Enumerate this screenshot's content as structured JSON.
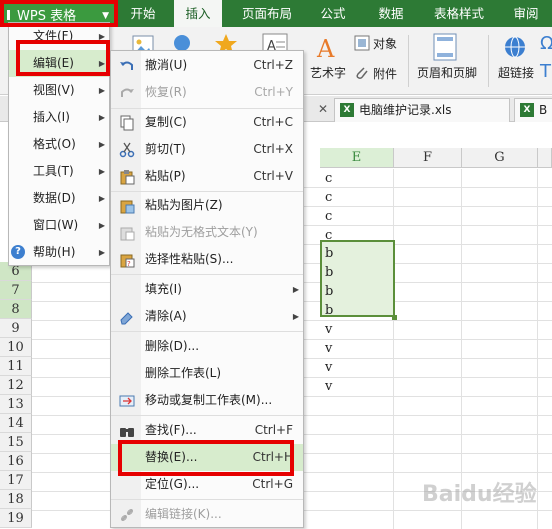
{
  "app": {
    "title": "WPS 表格"
  },
  "menubar": {
    "tabs": [
      "开始",
      "插入",
      "页面布局",
      "公式",
      "数据",
      "表格样式",
      "审阅"
    ]
  },
  "ribbon": {
    "art_text": "艺术字",
    "object": "对象",
    "attachment": "附件",
    "header_footer": "页眉和页脚",
    "hyperlink": "超链接"
  },
  "filetabs": {
    "tab1": "电脑维护记录.xls",
    "tab2": "B"
  },
  "grid": {
    "columns": [
      "E",
      "F",
      "G"
    ],
    "rows": [
      "6",
      "7",
      "8",
      "9",
      "10",
      "11",
      "12",
      "13",
      "14",
      "15",
      "16",
      "17",
      "18",
      "19"
    ],
    "e_values": [
      "c",
      "c",
      "c",
      "c",
      "b",
      "b",
      "b",
      "b",
      "v",
      "v",
      "v",
      "v"
    ]
  },
  "main_menu": {
    "items": [
      "文件(F)",
      "编辑(E)",
      "视图(V)",
      "插入(I)",
      "格式(O)",
      "工具(T)",
      "数据(D)",
      "窗口(W)",
      "帮助(H)"
    ]
  },
  "edit_menu": {
    "undo": "撤消(U)",
    "undo_sc": "Ctrl+Z",
    "redo": "恢复(R)",
    "redo_sc": "Ctrl+Y",
    "copy": "复制(C)",
    "copy_sc": "Ctrl+C",
    "cut": "剪切(T)",
    "cut_sc": "Ctrl+X",
    "paste": "粘贴(P)",
    "paste_sc": "Ctrl+V",
    "paste_pic": "粘贴为图片(Z)",
    "paste_text": "粘贴为无格式文本(Y)",
    "paste_special": "选择性粘贴(S)...",
    "fill": "填充(I)",
    "clear": "清除(A)",
    "delete": "删除(D)...",
    "delete_sheet": "删除工作表(L)",
    "move_copy": "移动或复制工作表(M)...",
    "find": "查找(F)...",
    "find_sc": "Ctrl+F",
    "replace": "替换(E)...",
    "replace_sc": "Ctrl+H",
    "goto": "定位(G)...",
    "goto_sc": "Ctrl+G",
    "edit_links": "编辑链接(K)..."
  },
  "watermark": "Baidu经验",
  "colors": {
    "menubar": "#2d7a35",
    "highlight_red": "#e60000",
    "selection_green": "#d7eccd"
  }
}
